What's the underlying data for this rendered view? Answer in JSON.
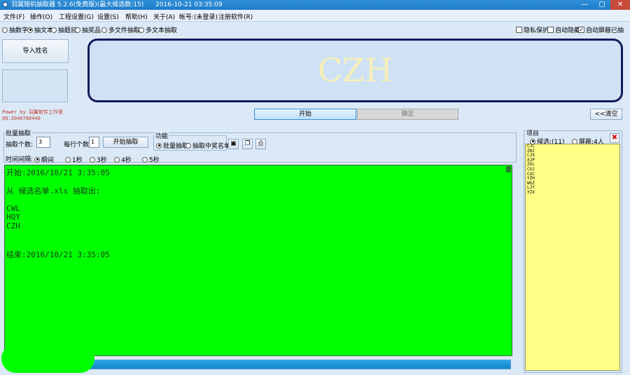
{
  "window": {
    "title": "羽翼随机抽取器 5.2.6(免费版)(最大候选数:15)",
    "timestamp": "2016-10-21 03:35:09",
    "min_glyph": "—",
    "max_glyph": "▢",
    "close_glyph": "✕"
  },
  "menu": [
    "文件(F)",
    "操作(O)",
    "工程设置(G)",
    "设置(S)",
    "帮助(H)",
    "关于(A)",
    "帐号:(未登录)",
    "注册软件(R)"
  ],
  "modes": [
    {
      "label": "抽数字",
      "selected": false
    },
    {
      "label": "抽文本",
      "selected": true
    },
    {
      "label": "抽题目",
      "selected": false
    },
    {
      "label": "抽奖品",
      "selected": false
    },
    {
      "label": "多文件抽取",
      "selected": false
    },
    {
      "label": "多文本抽取",
      "selected": false
    }
  ],
  "options": [
    {
      "label": "隐私保护",
      "checked": false
    },
    {
      "label": "自动隐藏",
      "checked": false
    },
    {
      "label": "自动屏蔽已抽",
      "checked": true
    }
  ],
  "import_button": "导入姓名",
  "power_text": "Power by 羽翼软件工作室",
  "qq_text": "QQ:2046788440",
  "display_text": "CZH",
  "start_button": "开始",
  "confirm_button": "确定",
  "clear_button": "<<清空",
  "batch": {
    "title": "批量抽取",
    "count_label": "抽取个数:",
    "count_value": "3",
    "per_row_label": "每行个数:",
    "per_row_value": "1",
    "start_label": "开始抽取",
    "function_title": "功能",
    "functions": [
      {
        "label": "批量抽取",
        "selected": true
      },
      {
        "label": "抽取中奖名单",
        "selected": false
      }
    ],
    "interval_label": "时间间隔:",
    "intervals": [
      {
        "label": "瞬间",
        "selected": true
      },
      {
        "label": "1秒",
        "selected": false
      },
      {
        "label": "3秒",
        "selected": false
      },
      {
        "label": "4秒",
        "selected": false
      },
      {
        "label": "5秒",
        "selected": false
      }
    ]
  },
  "log": {
    "start": "开始:2016/10/21 3:35:05",
    "source": "从 候选名单.xls 抽取出:",
    "names": [
      "CWL",
      "HQY",
      "CZH"
    ],
    "end": "结束:2016/10/21 3:35:05"
  },
  "project": {
    "title": "项目",
    "candidates_label": "候选:(11)",
    "candidates_selected": true,
    "blocked_label": "屏蔽:4人",
    "blocked_selected": false,
    "delete_glyph": "✖",
    "names": [
      "CJC",
      "ZHJ",
      "CJX",
      "XJP",
      "ZXL",
      "CGJ",
      "CXC",
      "YZH",
      "WGZ",
      "LJY",
      "YZX"
    ]
  }
}
